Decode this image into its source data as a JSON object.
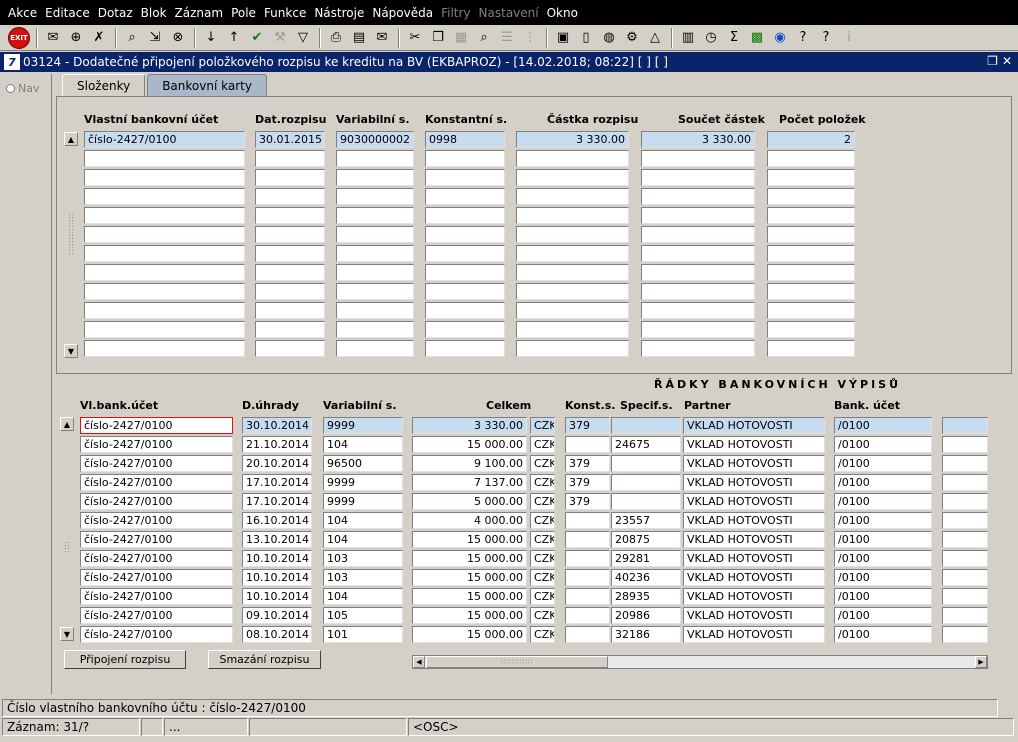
{
  "menu": [
    "Akce",
    "Editace",
    "Dotaz",
    "Blok",
    "Záznam",
    "Pole",
    "Funkce",
    "Nástroje",
    "Nápověda",
    "Filtry",
    "Nastavení",
    "Okno"
  ],
  "menu_disabled": [
    "Filtry",
    "Nastavení"
  ],
  "toolbar": {
    "exit_label": "EXIT"
  },
  "window": {
    "title": "03124 - Dodatečné připojení položkového rozpisu ke kreditu na BV (EKBAPROZ) - [14.02.2018; 08:22]  [ ]  [ ]"
  },
  "nav": {
    "label": "Nav"
  },
  "tabs": [
    {
      "label": "Složenky",
      "active": true
    },
    {
      "label": "Bankovní karty",
      "active": false
    }
  ],
  "top_table": {
    "headers": [
      "Vlastní bankovní účet",
      "Dat.rozpisu",
      "Variabilní s.",
      "Konstantní s.",
      "Částka rozpisu",
      "Součet částek",
      "Počet položek"
    ],
    "rows": [
      [
        "číslo-2427/0100",
        "30.01.2015",
        "9030000002",
        "0998",
        "3 330.00",
        "3 330.00",
        "2"
      ]
    ],
    "visible_row_count": 12
  },
  "bottom_section": {
    "title": "ŘÁDKY BANKOVNÍCH VÝPISŮ",
    "headers": [
      "Vl.bank.účet",
      "D.úhrady",
      "Variabilní s.",
      "Celkem",
      "Konst.s.",
      "Specif.s.",
      "Partner",
      "Bank. účet"
    ],
    "rows": [
      [
        "číslo-2427/0100",
        "30.10.2014",
        "9999",
        "3 330.00",
        "CZK",
        "379",
        "",
        "VKLAD HOTOVOSTI",
        "/0100"
      ],
      [
        "číslo-2427/0100",
        "21.10.2014",
        "104",
        "15 000.00",
        "CZK",
        "",
        "24675",
        "VKLAD HOTOVOSTI",
        "/0100"
      ],
      [
        "číslo-2427/0100",
        "20.10.2014",
        "96500",
        "9 100.00",
        "CZK",
        "379",
        "",
        "VKLAD HOTOVOSTI",
        "/0100"
      ],
      [
        "číslo-2427/0100",
        "17.10.2014",
        "9999",
        "7 137.00",
        "CZK",
        "379",
        "",
        "VKLAD HOTOVOSTI",
        "/0100"
      ],
      [
        "číslo-2427/0100",
        "17.10.2014",
        "9999",
        "5 000.00",
        "CZK",
        "379",
        "",
        "VKLAD HOTOVOSTI",
        "/0100"
      ],
      [
        "číslo-2427/0100",
        "16.10.2014",
        "104",
        "4 000.00",
        "CZK",
        "",
        "23557",
        "VKLAD HOTOVOSTI",
        "/0100"
      ],
      [
        "číslo-2427/0100",
        "13.10.2014",
        "104",
        "15 000.00",
        "CZK",
        "",
        "20875",
        "VKLAD HOTOVOSTI",
        "/0100"
      ],
      [
        "číslo-2427/0100",
        "10.10.2014",
        "103",
        "15 000.00",
        "CZK",
        "",
        "29281",
        "VKLAD HOTOVOSTI",
        "/0100"
      ],
      [
        "číslo-2427/0100",
        "10.10.2014",
        "103",
        "15 000.00",
        "CZK",
        "",
        "40236",
        "VKLAD HOTOVOSTI",
        "/0100"
      ],
      [
        "číslo-2427/0100",
        "10.10.2014",
        "104",
        "15 000.00",
        "CZK",
        "",
        "28935",
        "VKLAD HOTOVOSTI",
        "/0100"
      ],
      [
        "číslo-2427/0100",
        "09.10.2014",
        "105",
        "15 000.00",
        "CZK",
        "",
        "20986",
        "VKLAD HOTOVOSTI",
        "/0100"
      ],
      [
        "číslo-2427/0100",
        "08.10.2014",
        "101",
        "15 000.00",
        "CZK",
        "",
        "32186",
        "VKLAD HOTOVOSTI",
        "/0100"
      ]
    ]
  },
  "buttons": {
    "attach": "Připojení rozpisu",
    "delete": "Smazání rozpisu"
  },
  "status": {
    "hint": "Číslo vlastního bankovního účtu : číslo-2427/0100",
    "record": "Záznam: 31/?",
    "ellipsis": "...",
    "mode": "<OSC>"
  },
  "colors": {
    "title_bar": "#0a246a",
    "selected_row": "#c8dcf0",
    "focus_border": "#e01010"
  }
}
